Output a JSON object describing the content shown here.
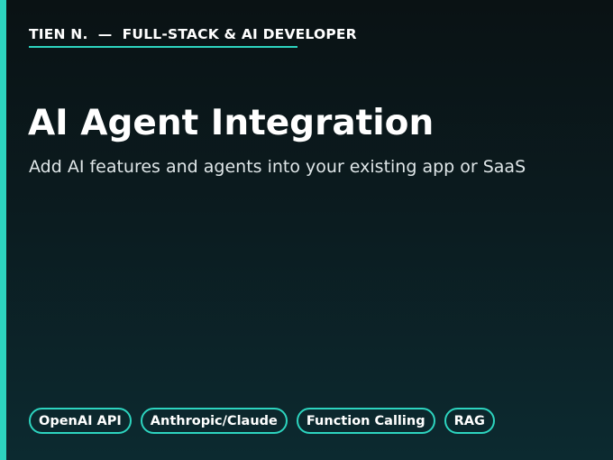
{
  "header": {
    "byline": "TIEN N.  —  FULL-STACK & AI DEVELOPER"
  },
  "hero": {
    "title": "AI Agent Integration",
    "subtitle": "Add AI features and agents into your existing app or SaaS"
  },
  "tags": [
    "OpenAI API",
    "Anthropic/Claude",
    "Function Calling",
    "RAG"
  ],
  "colors": {
    "accent": "#2dd4bf",
    "background_top": "#0a1214",
    "background_bottom": "#0c2a30"
  }
}
